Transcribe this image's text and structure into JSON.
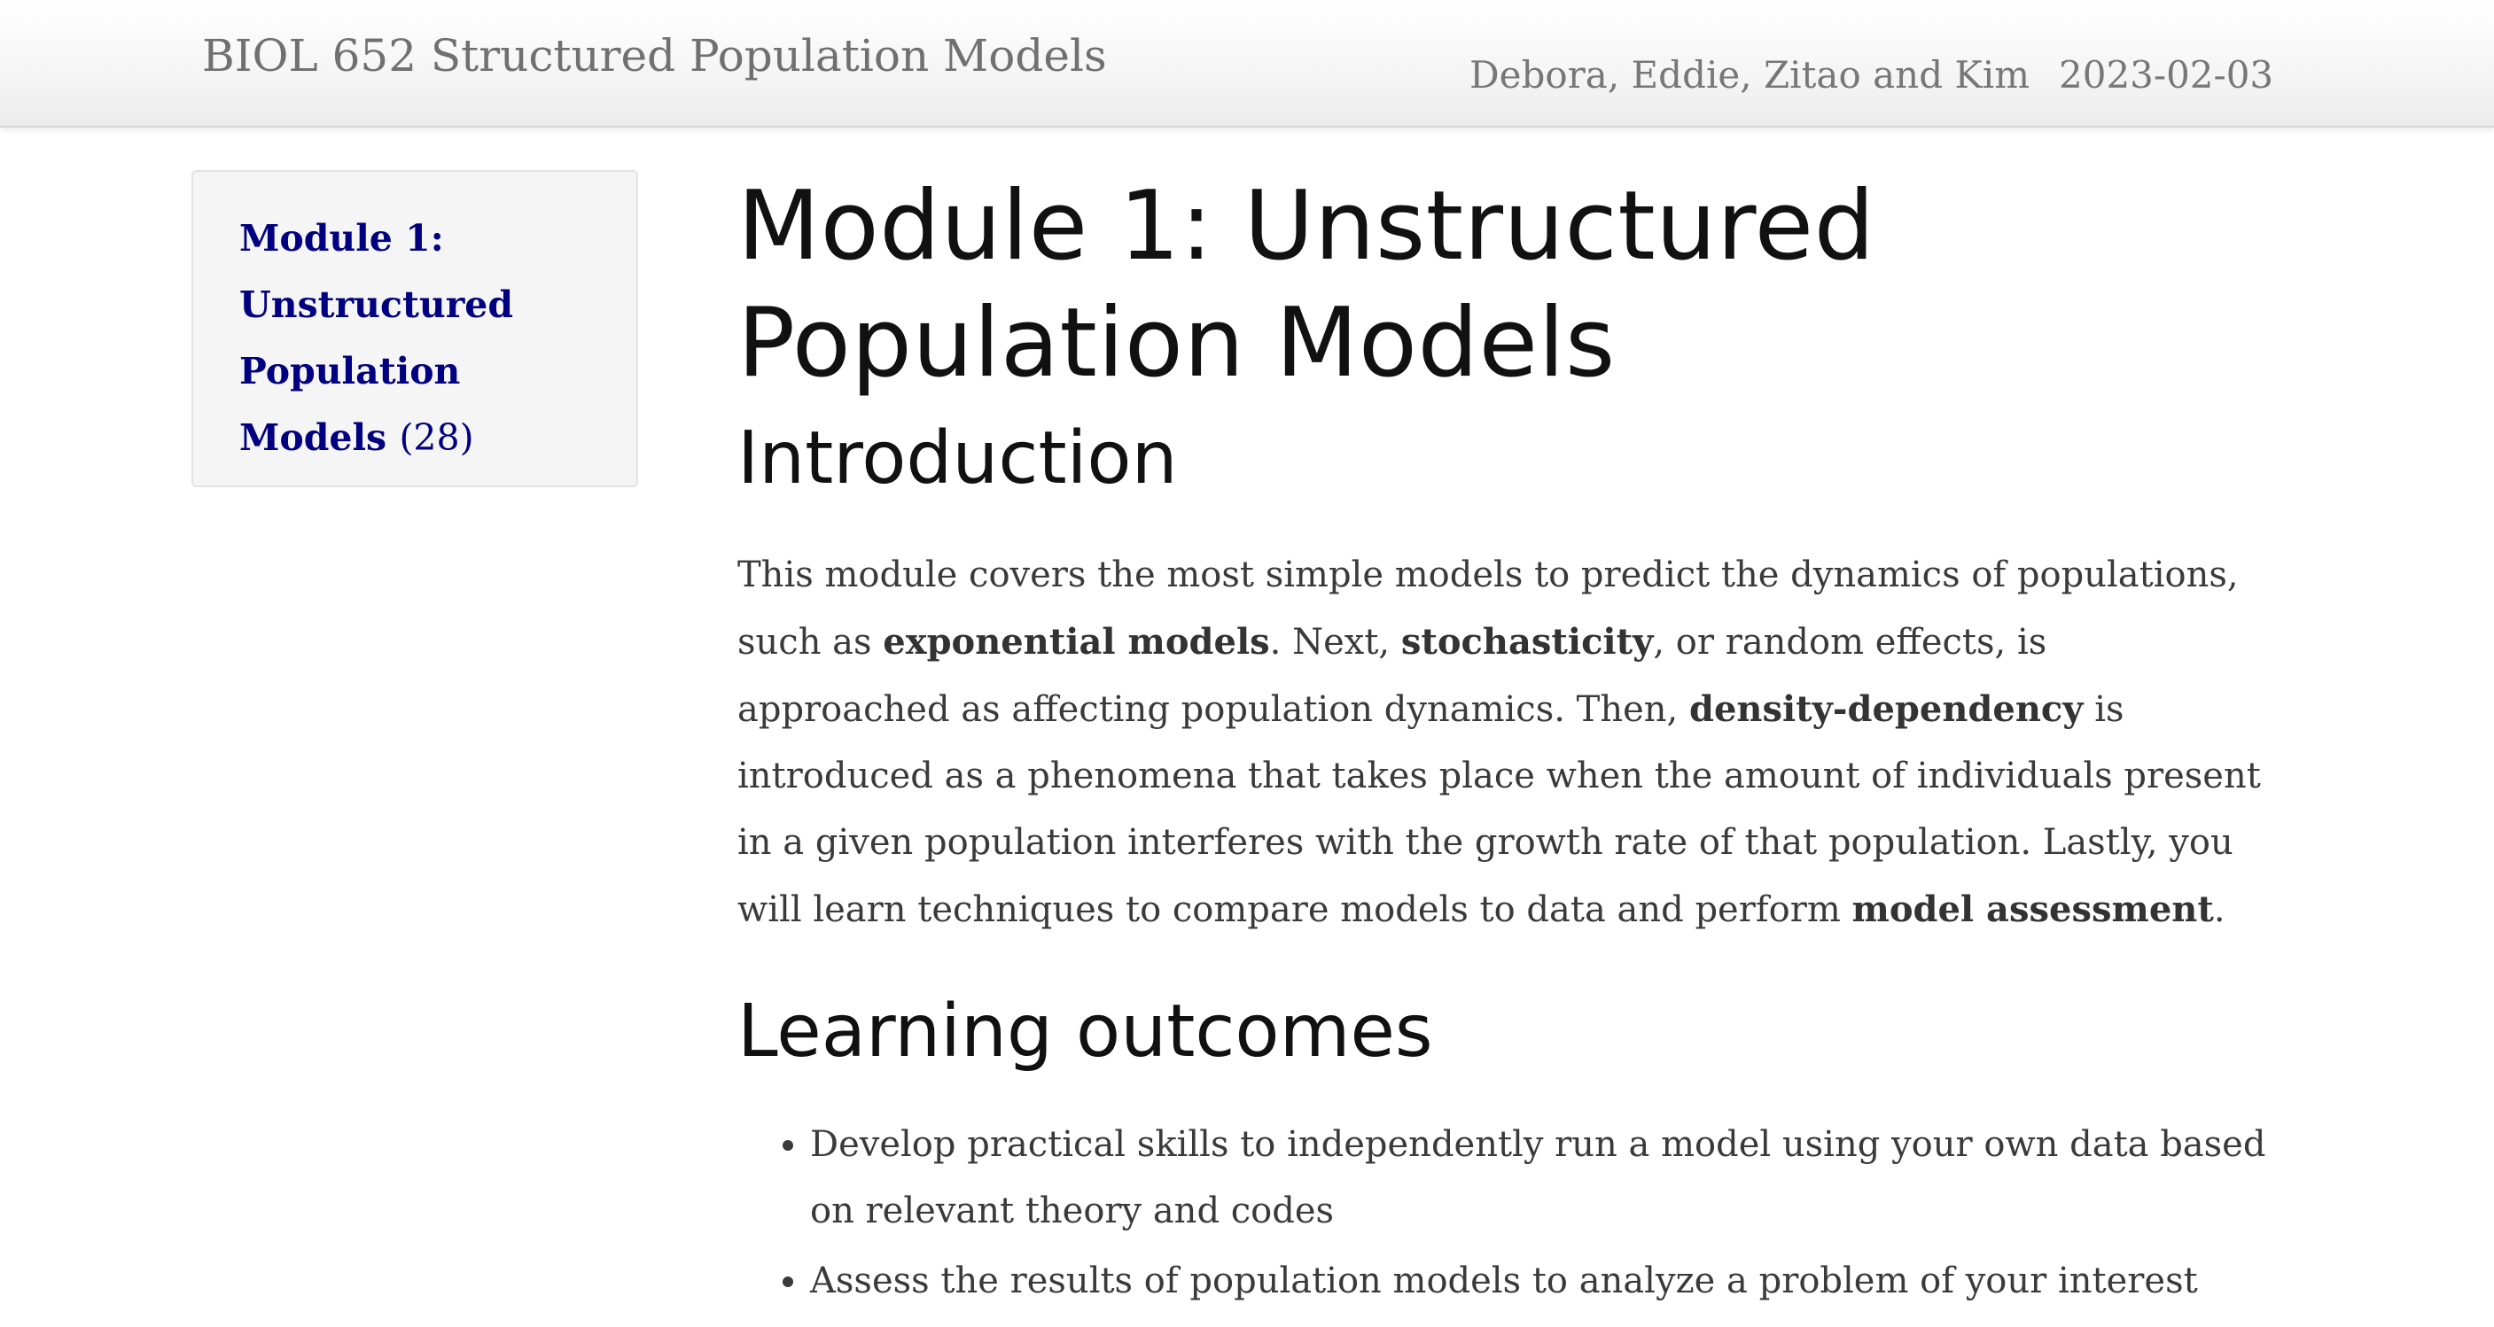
{
  "header": {
    "site_title": "BIOL 652 Structured Population Models",
    "author": "Debora, Eddie, Zitao and Kim",
    "date": "2023-02-03"
  },
  "toc": {
    "link_label": "Module 1: Unstructured Population Models",
    "link_count": "(28)"
  },
  "main": {
    "title": "Module 1: Unstructured Population Models",
    "introduction_heading": "Introduction",
    "intro": {
      "t1": "This module covers the most simple models to predict the dynamics of populations, such as ",
      "b1": "exponential models",
      "t2": ". Next, ",
      "b2": "stochasticity",
      "t3": ", or random effects, is approached as affecting population dynamics. Then, ",
      "b3": "density-dependency",
      "t4": " is introduced as a phenomena that takes place when the amount of individuals present in a given population interferes with the growth rate of that population. Lastly, you will learn techniques to compare models to data and perform ",
      "b4": "model assessment",
      "t5": "."
    },
    "learning_outcomes_heading": "Learning outcomes",
    "learning_outcomes": [
      "Develop practical skills to independently run a model using your own data based on relevant theory and codes",
      "Assess the results of population models to analyze a problem of your interest"
    ]
  }
}
